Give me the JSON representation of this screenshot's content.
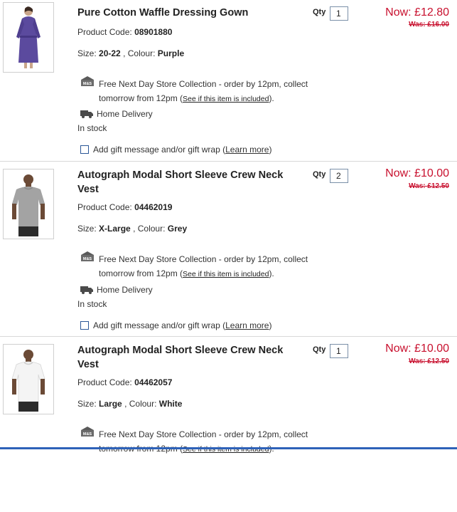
{
  "items": [
    {
      "title": "Pure Cotton Waffle Dressing Gown",
      "qty_label": "Qty",
      "qty": "1",
      "now_price": "Now: £12.80",
      "was_price": "Was: £16.00",
      "code_label": "Product Code:",
      "code": "08901880",
      "size_label": "Size:",
      "size": "20-22",
      "colour_label": ", Colour:",
      "colour": "Purple",
      "collection_text": "Free Next Day Store Collection - order by 12pm, collect tomorrow from 12pm (",
      "collection_link": "See if this item is included",
      "collection_end": ").",
      "delivery": "Home Delivery",
      "stock": "In stock",
      "gift_text": "Add gift message and/or gift wrap (",
      "gift_link": "Learn more",
      "gift_end": ")",
      "image_icon": "purple-dressing-gown-photo"
    },
    {
      "title": "Autograph Modal Short Sleeve Crew Neck Vest",
      "qty_label": "Qty",
      "qty": "2",
      "now_price": "Now: £10.00",
      "was_price": "Was: £12.50",
      "code_label": "Product Code:",
      "code": "04462019",
      "size_label": "Size:",
      "size": "X-Large",
      "colour_label": ", Colour:",
      "colour": "Grey",
      "collection_text": "Free Next Day Store Collection - order by 12pm, collect tomorrow from 12pm (",
      "collection_link": "See if this item is included",
      "collection_end": ").",
      "delivery": "Home Delivery",
      "stock": "In stock",
      "gift_text": "Add gift message and/or gift wrap (",
      "gift_link": "Learn more",
      "gift_end": ")",
      "image_icon": "grey-vest-photo"
    },
    {
      "title": "Autograph Modal Short Sleeve Crew Neck Vest",
      "qty_label": "Qty",
      "qty": "1",
      "now_price": "Now: £10.00",
      "was_price": "Was: £12.50",
      "code_label": "Product Code:",
      "code": "04462057",
      "size_label": "Size:",
      "size": "Large",
      "colour_label": ", Colour:",
      "colour": "White",
      "collection_text": "Free Next Day Store Collection - order by 12pm, collect tomorrow from 12pm (",
      "collection_link": "See if this item is included",
      "collection_end": ").",
      "image_icon": "white-vest-photo"
    }
  ],
  "icons": {
    "store_collection": "ms-store-icon",
    "delivery": "delivery-truck-icon",
    "gift_checkbox": "checkbox-icon"
  },
  "colors": {
    "price_red": "#c8102e",
    "accent_blue": "#2e62b8"
  }
}
